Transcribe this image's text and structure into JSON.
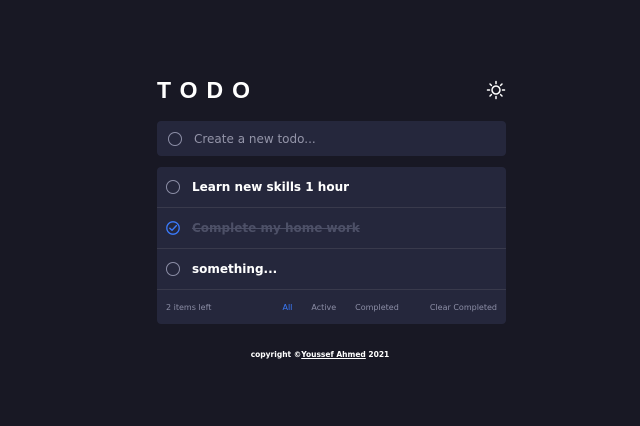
{
  "header": {
    "title": "TODO",
    "theme_icon": "sun-icon"
  },
  "new_todo": {
    "placeholder": "Create a new todo..."
  },
  "todos": [
    {
      "text": "Learn new skills 1 hour",
      "completed": false
    },
    {
      "text": "Complete my home work",
      "completed": true
    },
    {
      "text": "something...",
      "completed": false
    }
  ],
  "footer": {
    "items_left": "2 items left",
    "filters": [
      "All",
      "Active",
      "Completed"
    ],
    "active_filter": "All",
    "clear_label": "Clear Completed"
  },
  "copyright": {
    "prefix": "copyright ©",
    "author": "Youssef Ahmed",
    "year": " 2021"
  },
  "colors": {
    "background": "#181824",
    "card": "#25273c",
    "accent": "#3a7bfd",
    "text": "#ffffff",
    "muted": "#8b8da5",
    "completed_text": "#4d5067"
  }
}
